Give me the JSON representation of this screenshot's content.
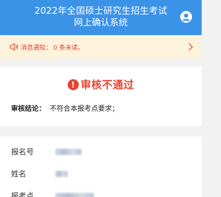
{
  "header": {
    "title_line1": "2022年全国硕士研究生招生考试",
    "title_line2": "网上确认系统",
    "user_icon": "user-circle-icon",
    "color": "#3b93e8"
  },
  "notice": {
    "label": "消息通知：",
    "count_text": "0 条未读。",
    "icon": "speaker-icon",
    "background": "#fdf2dc",
    "text_color": "#e0432f"
  },
  "result": {
    "status_icon_glyph": "!",
    "status_text": "审核不通过",
    "status_color": "#e8432f",
    "conclusion_label": "审核结论：",
    "conclusion_value": "不符合本报考点要求；"
  },
  "info": {
    "rows": [
      {
        "label": "报名号",
        "value": "███████"
      },
      {
        "label": "姓名",
        "value": "███"
      },
      {
        "label": "报考点",
        "value": "█████████"
      }
    ]
  }
}
